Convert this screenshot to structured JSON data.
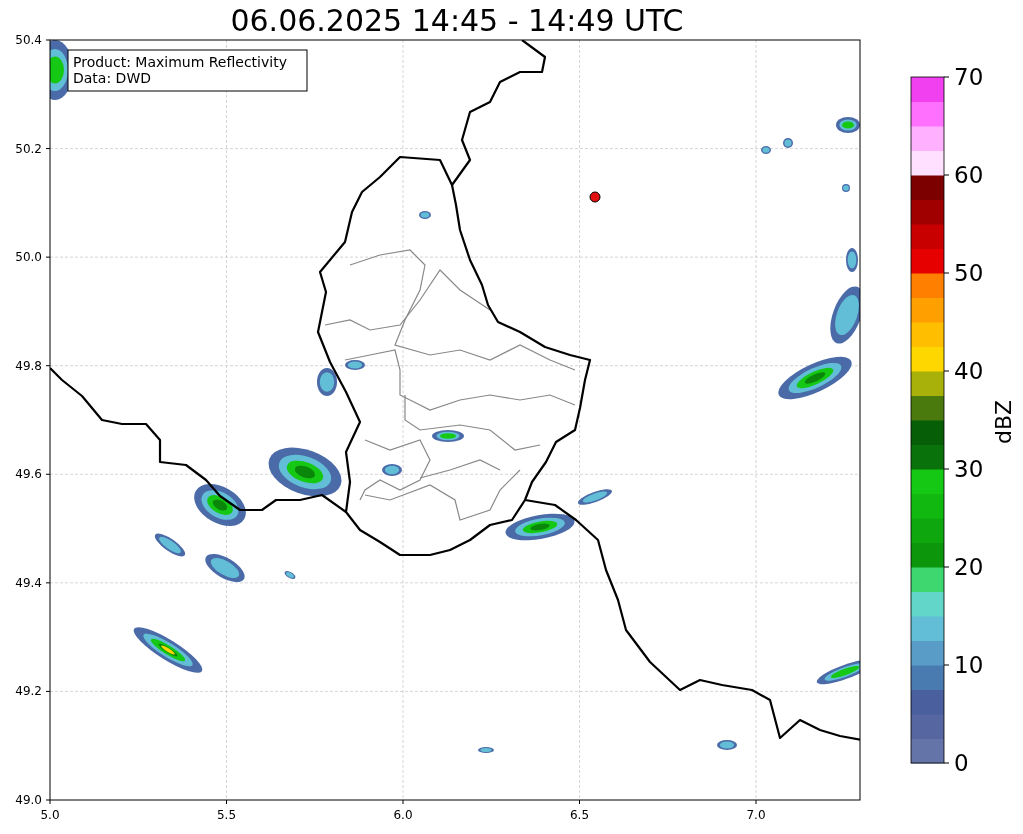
{
  "title": "06.06.2025 14:45 - 14:49 UTC",
  "info_box": {
    "lines": [
      "Product: Maximum Reflectivity",
      "Data: DWD"
    ]
  },
  "x_axis": {
    "ticks": [
      "5.0",
      "5.5",
      "6.0",
      "6.5",
      "7.0"
    ]
  },
  "y_axis": {
    "ticks": [
      "50.4",
      "50.2",
      "50.0",
      "49.8",
      "49.6",
      "49.4",
      "49.2",
      "49.0"
    ]
  },
  "colorbar": {
    "label": "dBZ",
    "ticks": [
      "70",
      "60",
      "50",
      "40",
      "30",
      "20",
      "10",
      "0"
    ],
    "segments": [
      {
        "color": "#6574a8"
      },
      {
        "color": "#5566a0"
      },
      {
        "color": "#4a5f9e"
      },
      {
        "color": "#4a7bb0"
      },
      {
        "color": "#5a9cc8"
      },
      {
        "color": "#62bed6"
      },
      {
        "color": "#62d6c8"
      },
      {
        "color": "#3ed66e"
      },
      {
        "color": "#0b960b"
      },
      {
        "color": "#0ea80e"
      },
      {
        "color": "#10b810"
      },
      {
        "color": "#14c814"
      },
      {
        "color": "#0a720a"
      },
      {
        "color": "#065e06"
      },
      {
        "color": "#4a7a0e"
      },
      {
        "color": "#a8b00a"
      },
      {
        "color": "#ffd700"
      },
      {
        "color": "#ffbf00"
      },
      {
        "color": "#ff9f00"
      },
      {
        "color": "#ff7f00"
      },
      {
        "color": "#e60000"
      },
      {
        "color": "#c80000"
      },
      {
        "color": "#a00000"
      },
      {
        "color": "#7d0000"
      },
      {
        "color": "#ffe0ff"
      },
      {
        "color": "#ffb0ff"
      },
      {
        "color": "#ff70ff"
      },
      {
        "color": "#f040f0"
      }
    ]
  }
}
